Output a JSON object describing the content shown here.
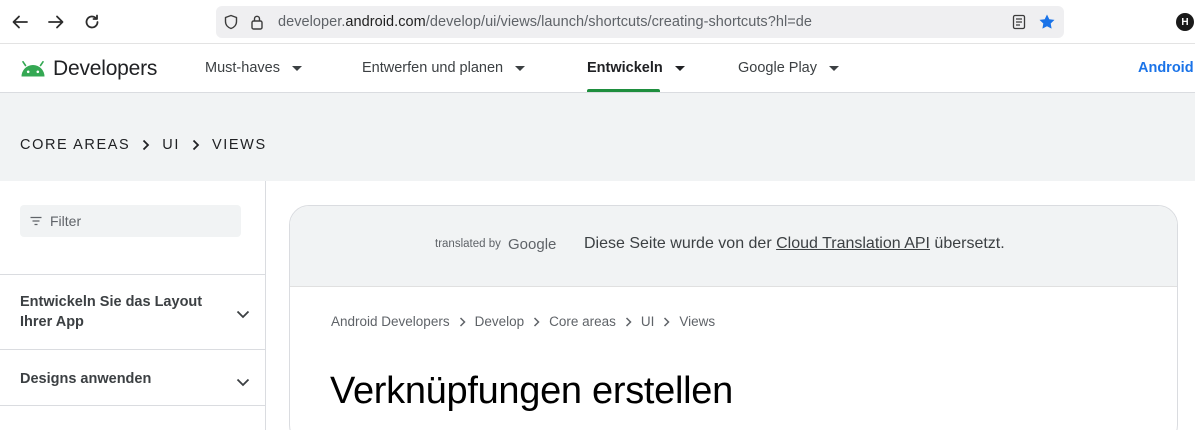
{
  "browser": {
    "url_prefix": "developer.",
    "url_host": "android.com",
    "url_path": "/develop/ui/views/launch/shortcuts/creating-shortcuts?hl=de",
    "profile_initial": "H",
    "bookmark_color": "#1a73e8"
  },
  "header": {
    "logo_text": "Developers",
    "nav": [
      {
        "label": "Must-haves"
      },
      {
        "label": "Entwerfen und planen"
      },
      {
        "label": "Entwickeln",
        "active": true
      },
      {
        "label": "Google Play"
      }
    ],
    "right_link": "Android",
    "accent_color": "#1e8e3e"
  },
  "band": {
    "crumbs": [
      "CORE AREAS",
      "UI",
      "VIEWS"
    ]
  },
  "sidebar": {
    "filter_placeholder": "Filter",
    "items": [
      {
        "label": "Entwickeln Sie das Layout Ihrer App"
      },
      {
        "label": "Designs anwenden"
      }
    ]
  },
  "content": {
    "translated_by": "translated by",
    "google": "Google",
    "translation_msg_prefix": "Diese Seite wurde von der ",
    "translation_link": "Cloud Translation API",
    "translation_msg_suffix": " übersetzt.",
    "breadcrumb": [
      "Android Developers",
      "Develop",
      "Core areas",
      "UI",
      "Views"
    ],
    "title": "Verknüpfungen erstellen"
  }
}
